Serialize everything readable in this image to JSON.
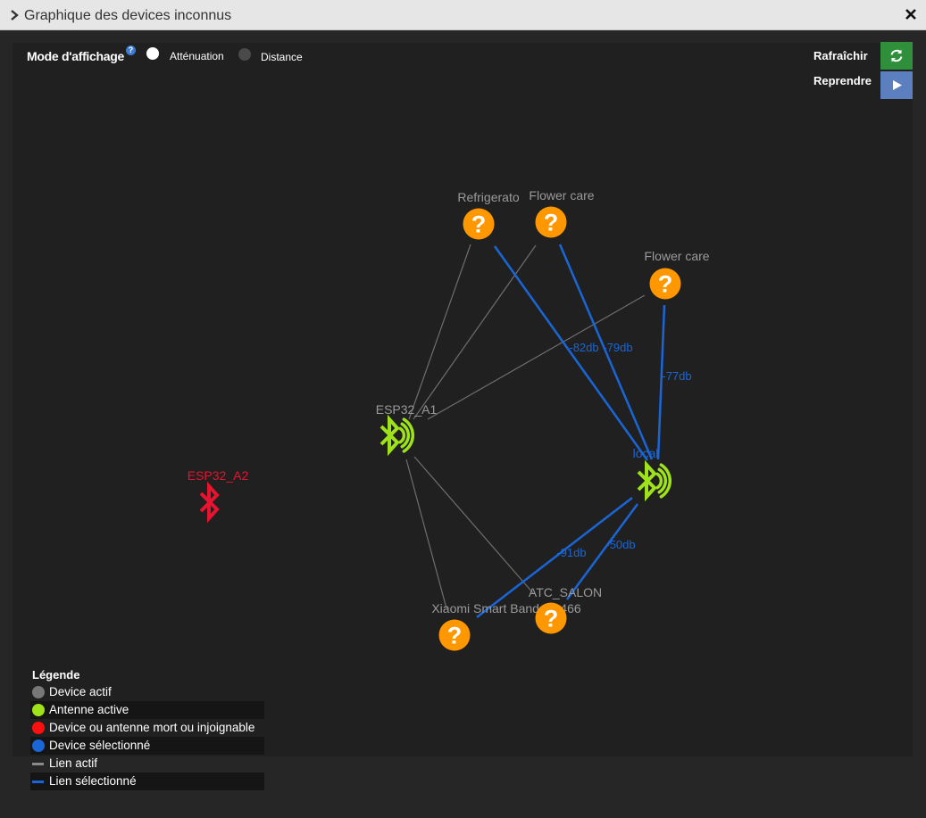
{
  "window": {
    "title": "Graphique des devices inconnus"
  },
  "controls": {
    "mode_label": "Mode d'affichage",
    "help_icon": "?",
    "options": [
      "Atténuation",
      "Distance"
    ],
    "selected": "Atténuation",
    "refresh_label": "Rafraîchir",
    "resume_label": "Reprendre"
  },
  "graph": {
    "nodes": [
      {
        "id": "refrigerato",
        "label": "Refrigerato",
        "type": "device"
      },
      {
        "id": "flowercare1",
        "label": "Flower care",
        "type": "device"
      },
      {
        "id": "flowercare2",
        "label": "Flower care",
        "type": "device"
      },
      {
        "id": "esp32a1",
        "label": "ESP32_A1",
        "type": "antenna"
      },
      {
        "id": "local",
        "label": "local",
        "type": "antenna-selected"
      },
      {
        "id": "esp32a2",
        "label": "ESP32_A2",
        "type": "antenna-dead"
      },
      {
        "id": "xiaomi",
        "label": "Xiaomi Smart Band 8 8466",
        "type": "device"
      },
      {
        "id": "atcsalon",
        "label": "ATC_SALON",
        "type": "device"
      }
    ],
    "links": [
      {
        "from": "esp32a1",
        "to": "refrigerato",
        "state": "active",
        "label": ""
      },
      {
        "from": "esp32a1",
        "to": "flowercare1",
        "state": "active",
        "label": ""
      },
      {
        "from": "esp32a1",
        "to": "flowercare2",
        "state": "active",
        "label": ""
      },
      {
        "from": "esp32a1",
        "to": "xiaomi",
        "state": "active",
        "label": ""
      },
      {
        "from": "esp32a1",
        "to": "atcsalon",
        "state": "active",
        "label": ""
      },
      {
        "from": "local",
        "to": "refrigerato",
        "state": "selected",
        "label": "-82db"
      },
      {
        "from": "local",
        "to": "flowercare1",
        "state": "selected",
        "label": "-79db"
      },
      {
        "from": "local",
        "to": "flowercare2",
        "state": "selected",
        "label": "-77db"
      },
      {
        "from": "local",
        "to": "xiaomi",
        "state": "selected",
        "label": "-91db"
      },
      {
        "from": "local",
        "to": "atcsalon",
        "state": "selected",
        "label": "-50db"
      }
    ]
  },
  "legend": {
    "title": "Légende",
    "items": [
      {
        "label": "Device actif",
        "kind": "dot",
        "color": "#777777"
      },
      {
        "label": "Antenne active",
        "kind": "dot",
        "color": "#9ee21a"
      },
      {
        "label": "Device ou antenne mort ou injoignable",
        "kind": "dot",
        "color": "#ff1010"
      },
      {
        "label": "Device sélectionné",
        "kind": "dot",
        "color": "#1a66d6"
      },
      {
        "label": "Lien actif",
        "kind": "line",
        "color": "#8a8a8a"
      },
      {
        "label": "Lien sélectionné",
        "kind": "line",
        "color": "#1a66d6"
      }
    ]
  },
  "colors": {
    "device": "#ff9800",
    "antenna_active": "#9ee21a",
    "antenna_dead": "#e8132e",
    "link_active": "#6e6e6e",
    "link_selected": "#1a66d6",
    "label_device": "#9a9a9a",
    "label_selected": "#1a66d6",
    "label_dead": "#e8132e"
  },
  "icons": {
    "title_chevron": "chevron-right-icon",
    "close": "close-icon",
    "refresh": "refresh-icon",
    "resume": "play-icon",
    "device": "question-mark-icon",
    "antenna": "bluetooth-signal-icon"
  }
}
